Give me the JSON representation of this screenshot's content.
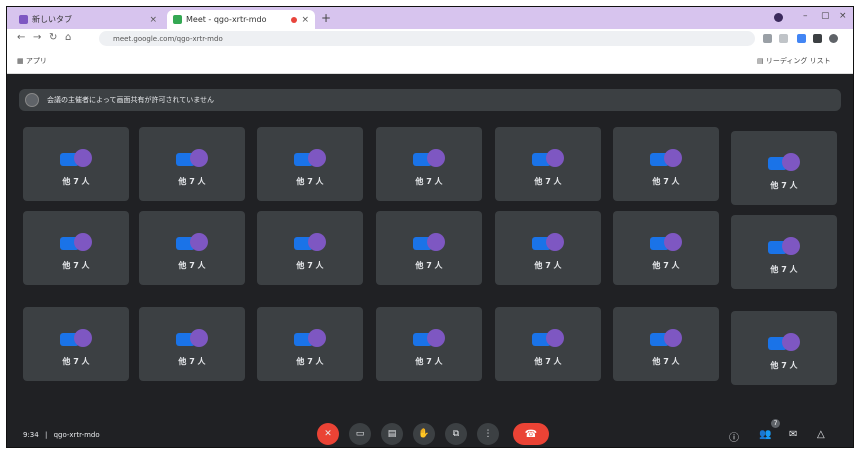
{
  "browser": {
    "tabs": [
      {
        "title": "新しいタブ",
        "favicon_color": "#7e57c2"
      },
      {
        "title": "Meet - qgo-xrtr-mdo",
        "favicon_color": "#34a853"
      }
    ],
    "new_tab": "+",
    "close": "×",
    "url": "meet.google.com/qgo-xrtr-mdo",
    "bookmarks_label": "アプリ",
    "reading_list_label": "リーディング リスト",
    "window_controls": {
      "minimize": "–",
      "maximize": "▢",
      "close": "×"
    }
  },
  "meet": {
    "notice": "会議の主催者によって画面共有が許可されていません",
    "tile_count_label": "他 7 人",
    "rows": 3,
    "cols": 7,
    "meeting_time": "9:34",
    "separator": "|",
    "meeting_code": "qgo-xrtr-mdo",
    "participant_badge": "7",
    "colors": {
      "background": "#202124",
      "tile": "#3c4043",
      "avatar_blue": "#1a73e8",
      "avatar_purple": "#7e57c2",
      "danger": "#ea4335"
    }
  }
}
